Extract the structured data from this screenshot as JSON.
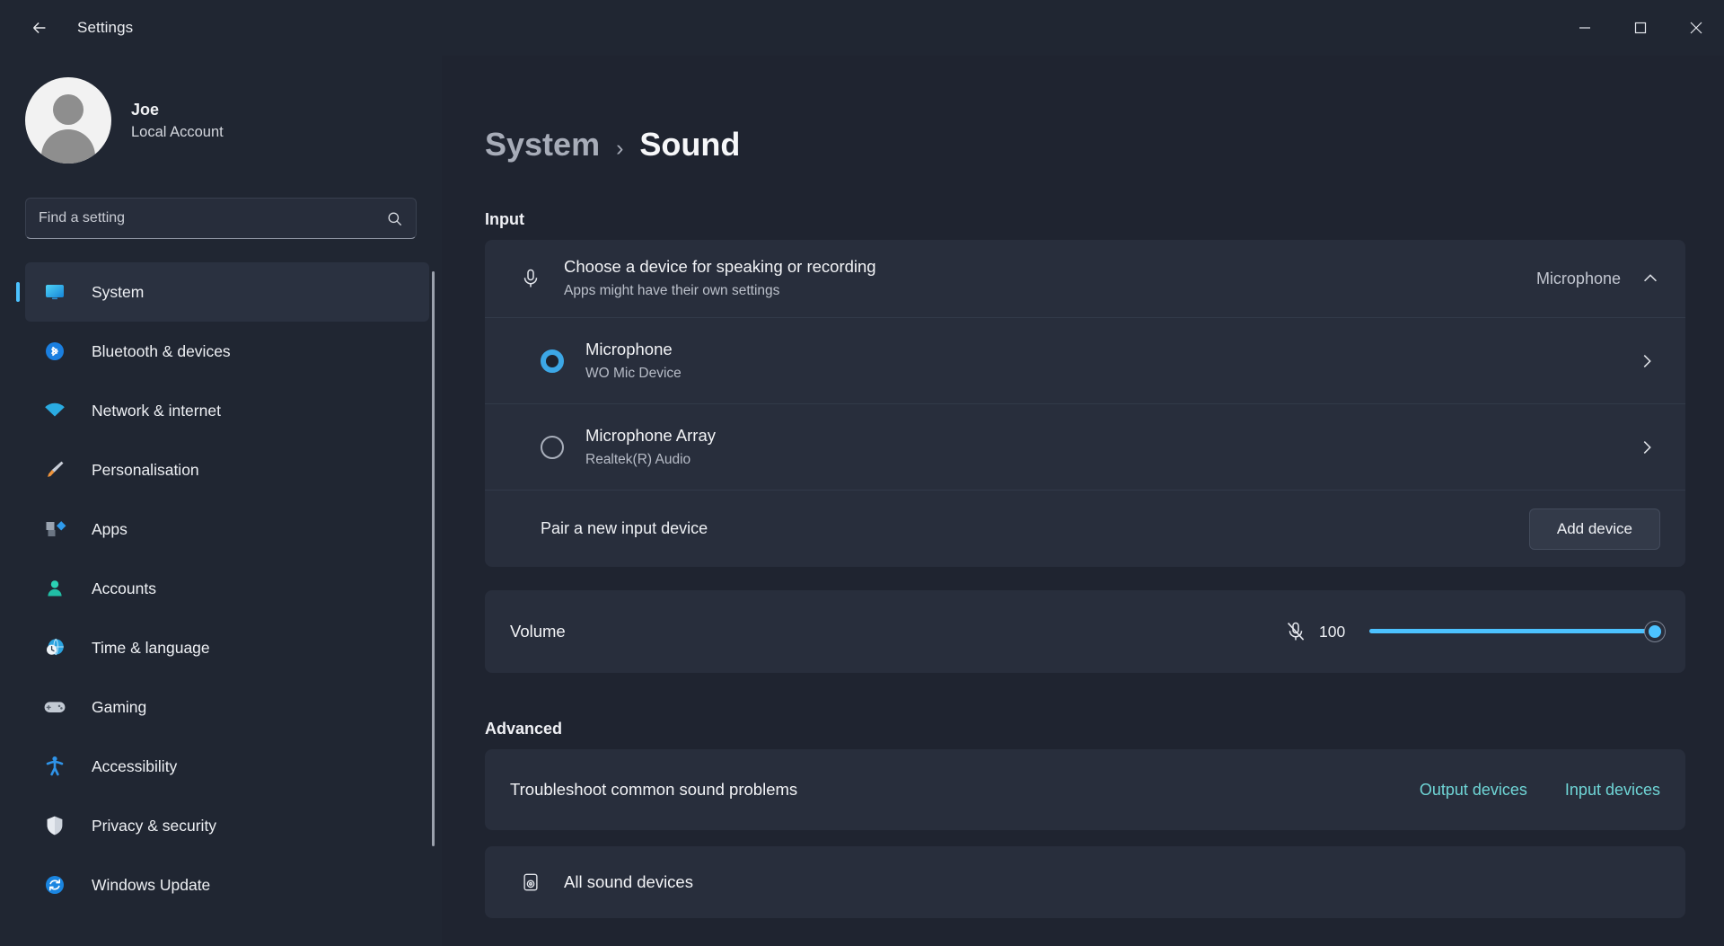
{
  "titlebar": {
    "back_label": "back-arrow",
    "title": "Settings",
    "minimize": "–",
    "maximize": "□",
    "close": "×"
  },
  "account": {
    "name": "Joe",
    "type": "Local Account"
  },
  "search": {
    "placeholder": "Find a setting",
    "value": ""
  },
  "sidebar": {
    "items": [
      {
        "label": "System",
        "icon": "monitor-icon",
        "active": true
      },
      {
        "label": "Bluetooth & devices",
        "icon": "bluetooth-icon",
        "active": false
      },
      {
        "label": "Network & internet",
        "icon": "wifi-icon",
        "active": false
      },
      {
        "label": "Personalisation",
        "icon": "paintbrush-icon",
        "active": false
      },
      {
        "label": "Apps",
        "icon": "apps-icon",
        "active": false
      },
      {
        "label": "Accounts",
        "icon": "person-icon",
        "active": false
      },
      {
        "label": "Time & language",
        "icon": "clock-globe-icon",
        "active": false
      },
      {
        "label": "Gaming",
        "icon": "gamepad-icon",
        "active": false
      },
      {
        "label": "Accessibility",
        "icon": "accessibility-icon",
        "active": false
      },
      {
        "label": "Privacy & security",
        "icon": "shield-icon",
        "active": false
      },
      {
        "label": "Windows Update",
        "icon": "refresh-icon",
        "active": false
      }
    ]
  },
  "breadcrumb": {
    "root": "System",
    "separator": "›",
    "leaf": "Sound"
  },
  "input_section": {
    "heading": "Input",
    "choose_device": {
      "title": "Choose a device for speaking or recording",
      "subtitle": "Apps might have their own settings",
      "value": "Microphone",
      "expanded": true
    },
    "devices": [
      {
        "name": "Microphone",
        "description": "WO Mic Device",
        "selected": true
      },
      {
        "name": "Microphone Array",
        "description": "Realtek(R) Audio",
        "selected": false
      }
    ],
    "pair": {
      "label": "Pair a new input device",
      "button": "Add device"
    },
    "volume": {
      "label": "Volume",
      "value": "100",
      "percent": 100,
      "muted_icon": "mic-muted-icon"
    }
  },
  "advanced_section": {
    "heading": "Advanced",
    "troubleshoot": {
      "label": "Troubleshoot common sound problems",
      "links": [
        "Output devices",
        "Input devices"
      ]
    },
    "all_devices": {
      "label": "All sound devices"
    }
  },
  "colors": {
    "accent": "#4cc2ff",
    "link": "#6fd5d6",
    "card": "#282e3c",
    "sidebar": "#202632",
    "page": "#1f2430"
  }
}
